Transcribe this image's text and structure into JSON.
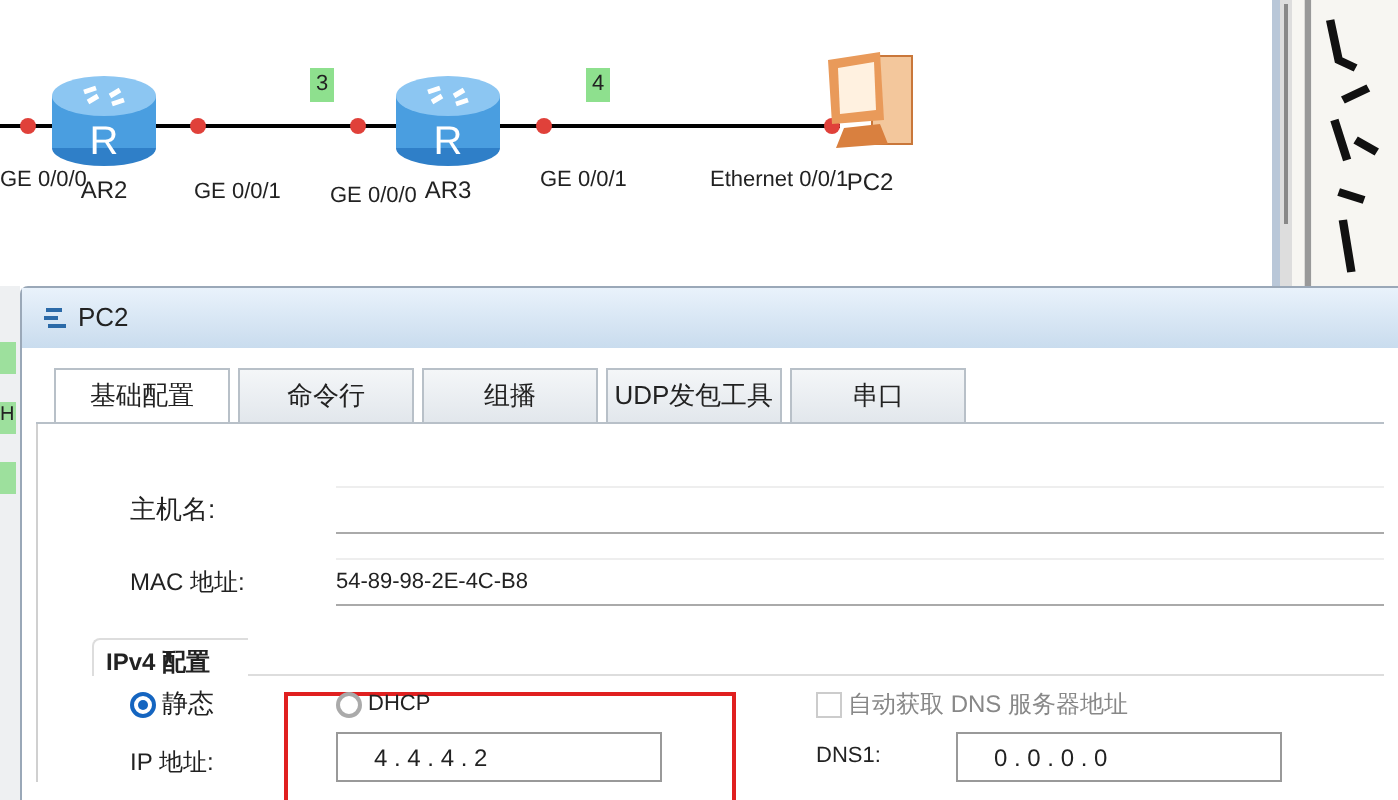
{
  "topology": {
    "devices": [
      {
        "kind": "router",
        "name": "AR2",
        "glyph": "R"
      },
      {
        "kind": "router",
        "name": "AR3",
        "glyph": "R"
      },
      {
        "kind": "pc",
        "name": "PC2"
      }
    ],
    "ports": [
      "GE 0/0/0",
      "GE 0/0/1",
      "GE 0/0/0",
      "GE 0/0/1",
      "Ethernet 0/0/1"
    ],
    "links": [
      "3",
      "4"
    ]
  },
  "background_tags": [
    {
      "label": "H"
    }
  ],
  "dialog": {
    "title": "PC2",
    "tabs": [
      {
        "label": "基础配置",
        "selected": true
      },
      {
        "label": "命令行",
        "selected": false
      },
      {
        "label": "组播",
        "selected": false
      },
      {
        "label": "UDP发包工具",
        "selected": false
      },
      {
        "label": "串口",
        "selected": false
      }
    ],
    "hostname": {
      "label": "主机名:"
    },
    "mac": {
      "label": "MAC 地址:",
      "value": "54-89-98-2E-4C-B8"
    },
    "ipv4": {
      "title": "IPv4 配置",
      "modes": [
        {
          "label": "静态",
          "selected": true
        },
        {
          "label": "DHCP",
          "selected": false
        }
      ],
      "ip": {
        "label": "IP 地址:",
        "value": "4 . 4 . 4 . 2"
      },
      "dns_auto": {
        "label": "自动获取 DNS 服务器地址",
        "checked": false,
        "disabled": true
      },
      "dns1": {
        "label": "DNS1:",
        "value": "0 . 0 . 0 . 0"
      },
      "highlight": true
    }
  }
}
